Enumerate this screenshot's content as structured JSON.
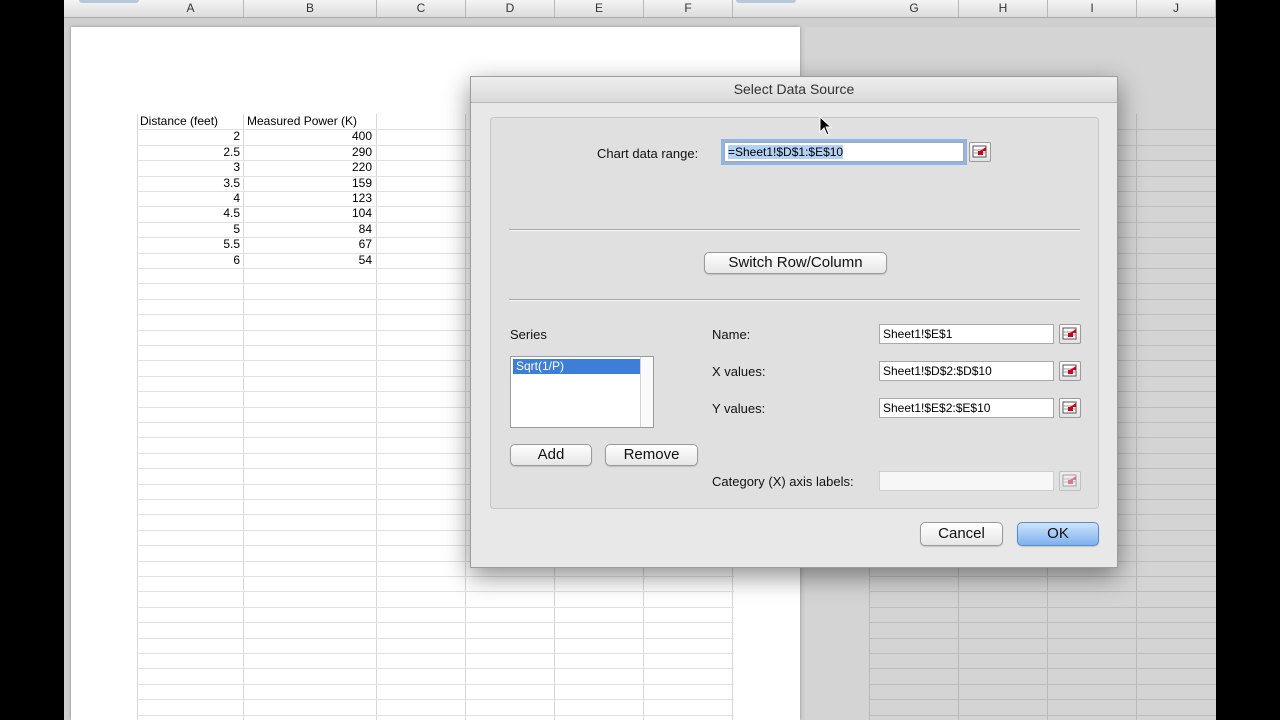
{
  "spreadsheet": {
    "columns_left": [
      "A",
      "B",
      "C",
      "D",
      "E",
      "F"
    ],
    "columns_right": [
      "G",
      "H",
      "I",
      "J"
    ],
    "headers": {
      "distance": "Distance (feet)",
      "power": "Measured Power (K)"
    },
    "rows": [
      {
        "distance": "2",
        "power": "400"
      },
      {
        "distance": "2.5",
        "power": "290"
      },
      {
        "distance": "3",
        "power": "220"
      },
      {
        "distance": "3.5",
        "power": "159"
      },
      {
        "distance": "4",
        "power": "123"
      },
      {
        "distance": "4.5",
        "power": "104"
      },
      {
        "distance": "5",
        "power": "84"
      },
      {
        "distance": "5.5",
        "power": "67"
      },
      {
        "distance": "6",
        "power": "54"
      }
    ]
  },
  "dialog": {
    "title": "Select Data Source",
    "chart_range_label": "Chart data range:",
    "chart_range_value": "=Sheet1!$D$1:$E$10",
    "switch_label": "Switch Row/Column",
    "series_label": "Series",
    "series_items": [
      "Sqrt(1/P)"
    ],
    "add_label": "Add",
    "remove_label": "Remove",
    "name_label": "Name:",
    "name_value": "Sheet1!$E$1",
    "x_label": "X values:",
    "x_value": "Sheet1!$D$2:$D$10",
    "y_label": "Y values:",
    "y_value": "Sheet1!$E$2:$E$10",
    "category_label": "Category (X) axis labels:",
    "category_value": "",
    "cancel_label": "Cancel",
    "ok_label": "OK"
  },
  "colors": {
    "selection": "#3d7fd7",
    "primary_button": "#7eb1ef",
    "focus_ring": "#8fb4e6"
  },
  "icons": {
    "range_picker": "range-picker-icon",
    "cursor": "mouse-pointer-icon"
  }
}
